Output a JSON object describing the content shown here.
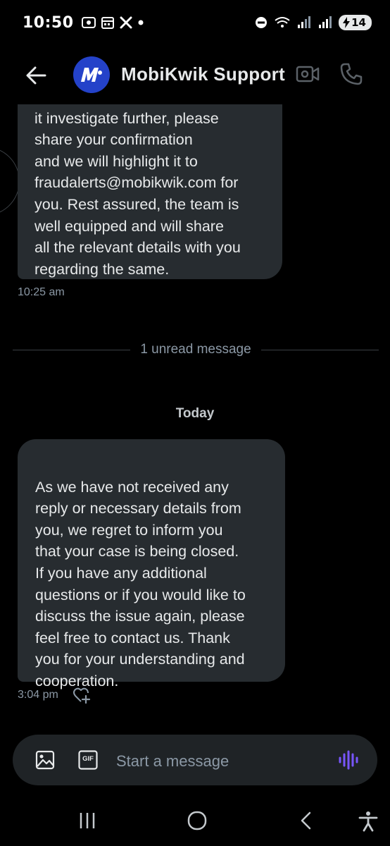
{
  "status_bar": {
    "time": "10:50",
    "battery": "14"
  },
  "header": {
    "contact_name": "MobiKwik Support"
  },
  "messages": {
    "first_text": "it investigate further, please\nshare your confirmation\nand we will highlight it to\nfraudalerts@mobikwik.com for\nyou. Rest assured, the team is\nwell equipped  and will share\nall the relevant details with you\nregarding the same.",
    "first_time": "10:25 am",
    "unread_label": "1 unread message",
    "date_label": "Today",
    "second_text": "As we have not received any\nreply or necessary details from\nyou, we regret to inform you\nthat your case is being closed.\nIf you have any additional\nquestions or if you would like to\ndiscuss the issue again, please\nfeel free to contact us. Thank\nyou for your understanding and\ncooperation.",
    "second_time": "3:04 pm"
  },
  "composer": {
    "placeholder": "Start a message",
    "gif_label": "GIF"
  },
  "colors": {
    "accent": "#7856ff",
    "bubble": "#272c30",
    "avatar": "#2442c9"
  },
  "icons": [
    "back-arrow-icon",
    "mobikwik-logo",
    "video-call-icon",
    "phone-icon",
    "heart-plus-icon",
    "image-icon",
    "gif-icon",
    "voice-wave-icon",
    "recent-apps-icon",
    "home-icon",
    "back-icon",
    "accessibility-icon"
  ]
}
